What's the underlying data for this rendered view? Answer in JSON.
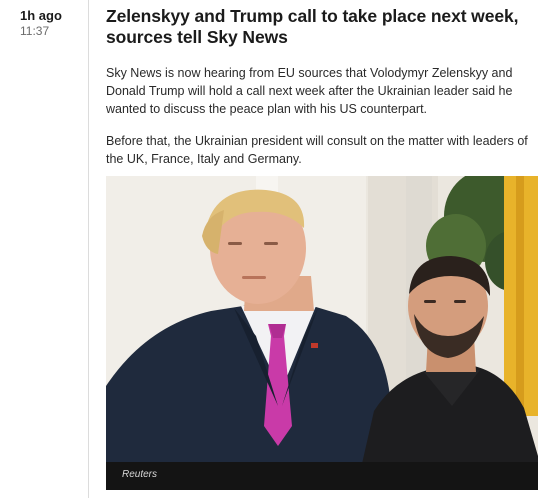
{
  "post": {
    "time_ago": "1h ago",
    "time_clock": "11:37",
    "headline": "Zelenskyy and Trump call to take place next week, sources tell Sky News",
    "paragraphs": [
      "Sky News is now hearing from EU sources that Volodymyr Zelenskyy and Donald Trump will hold a call next week after the Ukrainian leader said he wanted to discuss the peace plan with his US counterpart.",
      "Before that, the Ukrainian president will consult on the matter with leaders of the UK, France, Italy and Germany."
    ],
    "image": {
      "caption": "Reuters"
    }
  }
}
